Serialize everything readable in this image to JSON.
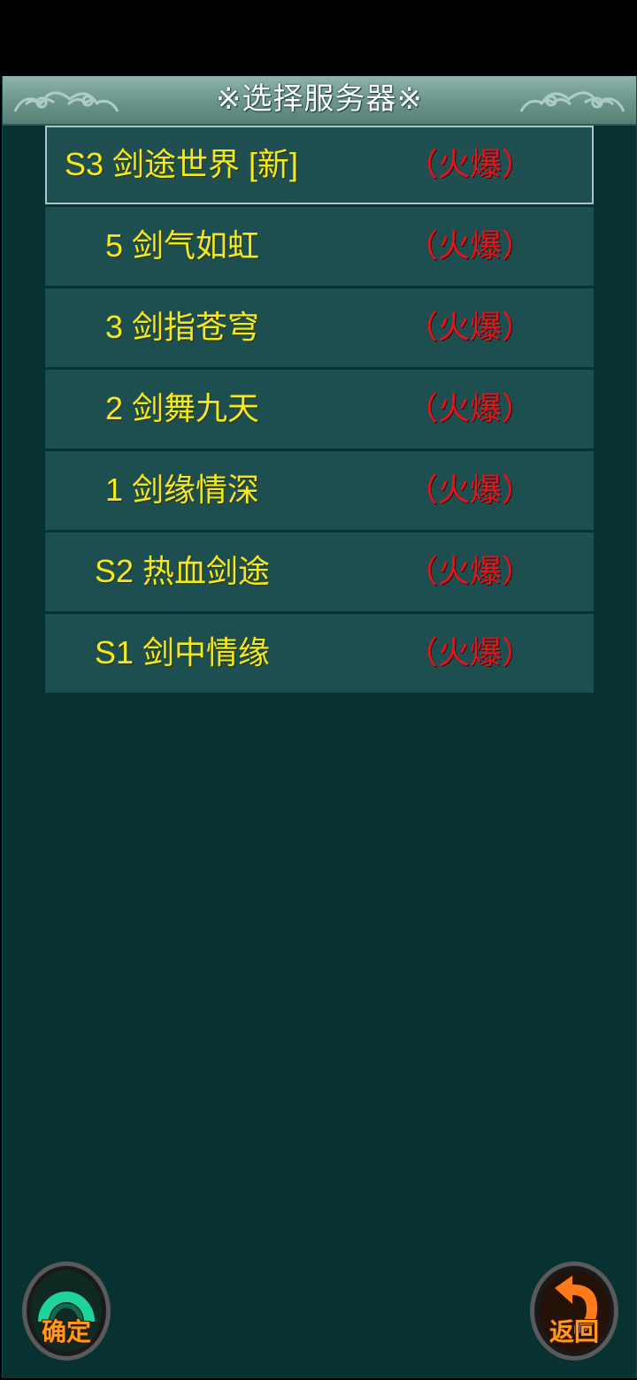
{
  "title": "※选择服务器※",
  "servers": [
    {
      "name": "S3 剑途世界 [新]",
      "status": "（火爆）",
      "selected": true
    },
    {
      "name": "5 剑气如虹",
      "status": "（火爆）"
    },
    {
      "name": "3 剑指苍穹",
      "status": "（火爆）"
    },
    {
      "name": "2 剑舞九天",
      "status": "（火爆）"
    },
    {
      "name": "1 剑缘情深",
      "status": "（火爆）"
    },
    {
      "name": "S2 热血剑途",
      "status": "（火爆）"
    },
    {
      "name": "S1 剑中情缘",
      "status": "（火爆）"
    }
  ],
  "buttons": {
    "confirm_label": "确定",
    "back_label": "返回"
  },
  "colors": {
    "background": "#083131",
    "row": "#1d4f50",
    "server_name": "#f2ea1e",
    "status": "#e8141c",
    "button_label": "#ff9a1a"
  },
  "icons": {
    "title_left": "cloud-ornament",
    "title_right": "cloud-ornament",
    "confirm": "green-arc-icon",
    "back": "return-arrow-icon"
  }
}
